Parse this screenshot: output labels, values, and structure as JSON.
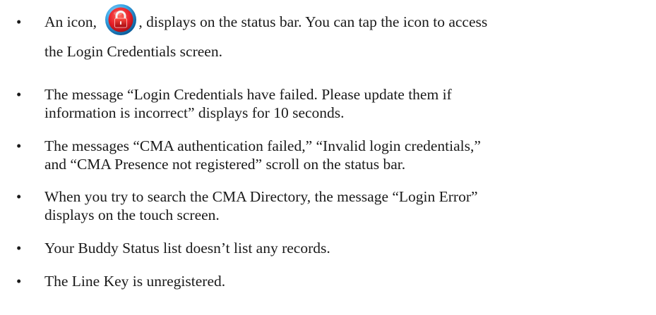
{
  "bullets": [
    {
      "line1_before_icon": "An icon, ",
      "line1_after_icon": ", displays on the status bar. You can tap the icon to access",
      "line2": "the Login Credentials screen."
    },
    {
      "line1": "The message “Login Credentials have failed. Please update them if",
      "line2": "information is incorrect” displays for 10 seconds."
    },
    {
      "line1": "The messages “CMA authentication failed,” “Invalid login credentials,”",
      "line2": "and “CMA Presence not registered” scroll on the status bar."
    },
    {
      "line1": "When you try to search the CMA Directory, the message “Login Error”",
      "line2": "displays on the touch screen."
    },
    {
      "line1": "Your Buddy Status list doesn’t list any records."
    },
    {
      "line1": "The Line Key is unregistered."
    }
  ],
  "bullet_symbol": "•",
  "icon": {
    "name": "login-credentials-lock-icon",
    "colors": {
      "ring": "#3aa8e8",
      "lock_body": "#e8202a",
      "shackle": "#f2f2f2"
    }
  }
}
